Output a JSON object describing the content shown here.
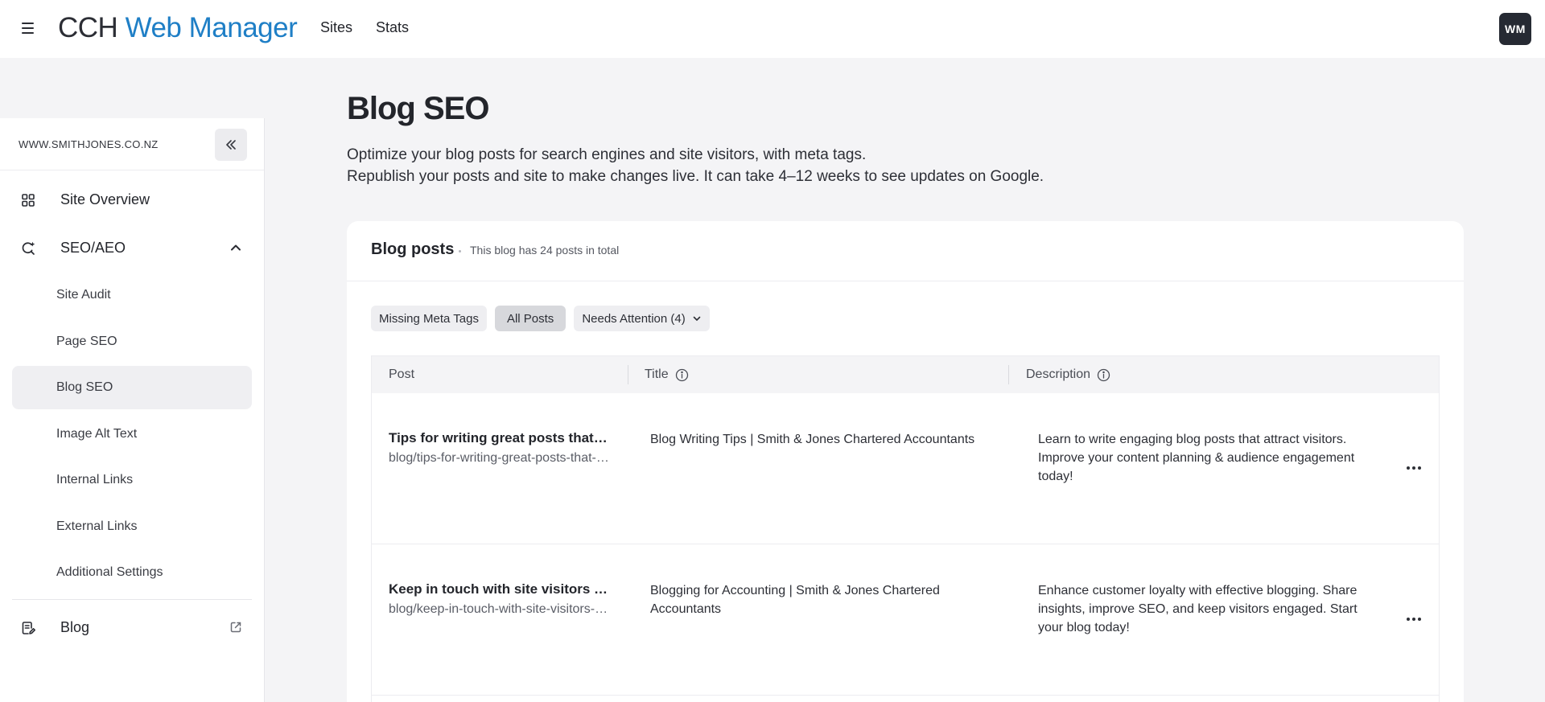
{
  "header": {
    "brand_part1": "CCH",
    "brand_part2": "Web Manager",
    "nav": [
      "Sites",
      "Stats"
    ],
    "avatar_initials": "WM"
  },
  "sidebar": {
    "site_url": "WWW.SMITHJONES.CO.NZ",
    "overview_label": "Site Overview",
    "seo_label": "SEO/AEO",
    "seo_items": [
      {
        "label": "Site Audit",
        "active": false
      },
      {
        "label": "Page SEO",
        "active": false
      },
      {
        "label": "Blog SEO",
        "active": true
      },
      {
        "label": "Image Alt Text",
        "active": false
      },
      {
        "label": "Internal Links",
        "active": false
      },
      {
        "label": "External Links",
        "active": false
      },
      {
        "label": "Additional Settings",
        "active": false
      }
    ],
    "blog_label": "Blog"
  },
  "main": {
    "title": "Blog SEO",
    "description_line1": "Optimize your blog posts for search engines and site visitors, with meta tags.",
    "description_line2": "Republish your posts and site to make changes live. It can take 4–12 weeks to see updates on Google.",
    "card": {
      "title": "Blog posts",
      "subtitle": "This blog has 24 posts in total",
      "filters": {
        "missing": "Missing Meta Tags",
        "all": "All Posts",
        "attention": "Needs Attention (4)"
      },
      "columns": {
        "post": "Post",
        "title": "Title",
        "description": "Description"
      },
      "rows": [
        {
          "post_title": "Tips for writing great posts that attract visitors",
          "slug": "blog/tips-for-writing-great-posts-that-attract-visitors",
          "title": "Blog Writing Tips | Smith & Jones Chartered Accountants",
          "description": "Learn to write engaging blog posts that attract visitors. Improve your content planning & audience engagement today!"
        },
        {
          "post_title": "Keep in touch with site visitors and customers",
          "slug": "blog/keep-in-touch-with-site-visitors-and-customers",
          "title": "Blogging for Accounting | Smith & Jones Chartered Accountants",
          "description": "Enhance customer loyalty with effective blogging. Share insights, improve SEO, and keep visitors engaged. Start your blog today!"
        }
      ]
    }
  },
  "colors": {
    "brand_blue": "#1f7fc6",
    "avatar_bg": "#262a33",
    "active_chip": "#d7d8dc"
  },
  "icons": [
    "hamburger-icon",
    "collapse-chevrons-icon",
    "overview-grid-icon",
    "seo-search-icon",
    "chevron-up-icon",
    "blog-icon",
    "external-link-icon",
    "info-icon",
    "chevron-down-icon",
    "more-horizontal-icon"
  ]
}
